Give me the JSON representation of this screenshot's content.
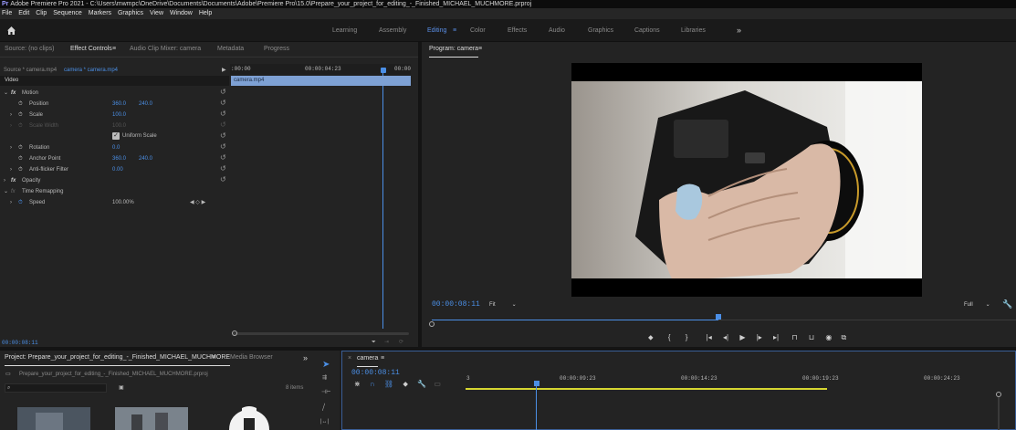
{
  "titlebar": {
    "text": "Adobe Premiere Pro 2021 - C:\\Users\\mwmpc\\OneDrive\\Documents\\Documents\\Adobe\\Premiere Pro\\15.0\\Prepare_your_project_for_editing_-_Finished_MICHAEL_MUCHMORE.prproj"
  },
  "menu": [
    "File",
    "Edit",
    "Clip",
    "Sequence",
    "Markers",
    "Graphics",
    "View",
    "Window",
    "Help"
  ],
  "workspaces": [
    "Learning",
    "Assembly",
    "Editing",
    "Color",
    "Effects",
    "Audio",
    "Graphics",
    "Captions",
    "Libraries"
  ],
  "workspace_more": "»",
  "workspace_menu_icon": "≡",
  "source_panel": {
    "tabs": [
      "Source: (no clips)",
      "Effect Controls",
      "Audio Clip Mixer: camera",
      "Metadata",
      "Progress"
    ],
    "menu_icon": "≡",
    "source_label": "Source * camera.mp4",
    "sequence_label": "camera * camera.mp4",
    "play_arrow": "▶",
    "ruler_start": ":00:00",
    "ruler_mid": "00:00:04:23",
    "ruler_end": "00:00",
    "clip_name": "camera.mp4",
    "video_label": "Video",
    "motion": "Motion",
    "position_label": "Position",
    "position_x": "360.0",
    "position_y": "240.0",
    "scale_label": "Scale",
    "scale_value": "100.0",
    "scale_width_label": "Scale Width",
    "scale_width_value": "100.0",
    "uniform_scale": "Uniform Scale",
    "rotation_label": "Rotation",
    "rotation_value": "0.0",
    "anchor_label": "Anchor Point",
    "anchor_x": "360.0",
    "anchor_y": "240.0",
    "antiflicker_label": "Anti-flicker Filter",
    "antiflicker_value": "0.00",
    "opacity": "Opacity",
    "time_remapping": "Time Remapping",
    "speed_label": "Speed",
    "speed_value": "100.00%",
    "fx": "fx",
    "timecode": "00:00:08:11"
  },
  "program": {
    "title": "Program: camera",
    "menu_icon": "≡",
    "timecode": "00:00:08:11",
    "fit": "Fit",
    "quality": "Full",
    "progress_fraction": 0.49
  },
  "project": {
    "tabs": [
      "Project: Prepare_your_project_for_editing_-_Finished_MICHAEL_MUCHMORE",
      "Media Browser"
    ],
    "menu_icon": "≡",
    "more_icon": "»",
    "file": "Prepare_your_project_for_editing_-_Finished_MICHAEL_MUCHMORE.prproj",
    "items": "8 items"
  },
  "timeline": {
    "close": "×",
    "name": "camera",
    "menu_icon": "≡",
    "timecode": "00:00:08:11",
    "ruler": [
      "3",
      "00:00:09:23",
      "00:00:14:23",
      "00:00:19:23",
      "00:00:24:23"
    ]
  },
  "colors": {
    "accent": "#4b8fe6",
    "work_area": "#d6d631",
    "panel": "#232323"
  }
}
